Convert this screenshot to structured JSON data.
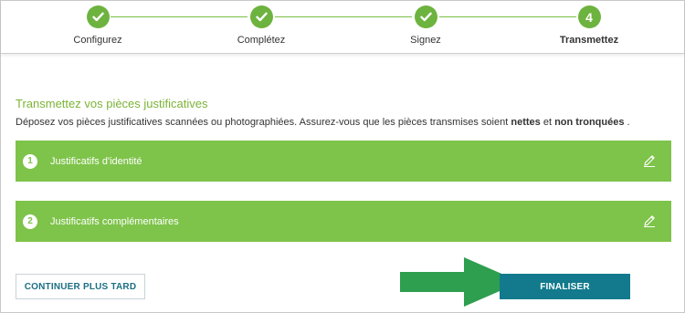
{
  "colors": {
    "brand_green": "#6db33f",
    "row_green": "#7ec34a",
    "title_green": "#7cb336",
    "teal": "#127a8c",
    "arrow_green": "#2e9e4f"
  },
  "stepper": {
    "steps": [
      {
        "label": "Configurez",
        "state": "done",
        "icon": "check-icon"
      },
      {
        "label": "Complétez",
        "state": "done",
        "icon": "check-icon"
      },
      {
        "label": "Signez",
        "state": "done",
        "icon": "check-icon"
      },
      {
        "label": "Transmettez",
        "state": "active",
        "number": "4"
      }
    ]
  },
  "main": {
    "title": "Transmettez vos pièces justificatives",
    "intro_before": "Déposez vos pièces justificatives scannées ou photographiées. Assurez-vous que les pièces transmises soient ",
    "intro_bold1": "nettes",
    "intro_mid": " et ",
    "intro_bold2": "non tronquées",
    "intro_after": " .",
    "documents": [
      {
        "number": "1",
        "label": "Justificatifs d'identité",
        "icon": "edit-pencil-icon"
      },
      {
        "number": "2",
        "label": "Justificatifs complémentaires",
        "icon": "edit-pencil-icon"
      }
    ]
  },
  "actions": {
    "later_label": "CONTINUER PLUS TARD",
    "finish_label": "FINALISER",
    "pointer_icon": "arrow-right-icon"
  }
}
